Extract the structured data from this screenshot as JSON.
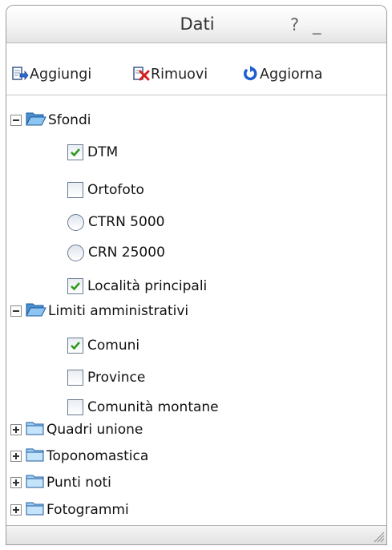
{
  "window": {
    "title": "Dati",
    "help_label": "?",
    "minimize_label": "_"
  },
  "toolbar": {
    "add_label": "Aggiungi",
    "remove_label": "Rimuovi",
    "refresh_label": "Aggiorna"
  },
  "tree": {
    "sfondi": {
      "label": "Sfondi",
      "expanded": true,
      "items": [
        {
          "label": "DTM",
          "control": "checkbox",
          "checked": true
        },
        {
          "label": "Ortofoto",
          "control": "checkbox",
          "checked": false
        },
        {
          "label": "CTRN 5000",
          "control": "radio",
          "checked": false
        },
        {
          "label": "CRN 25000",
          "control": "radio",
          "checked": false
        },
        {
          "label": "Località principali",
          "control": "checkbox",
          "checked": true
        }
      ]
    },
    "limiti": {
      "label": "Limiti amministrativi",
      "expanded": true,
      "items": [
        {
          "label": "Comuni",
          "control": "checkbox",
          "checked": true
        },
        {
          "label": "Province",
          "control": "checkbox",
          "checked": false
        },
        {
          "label": "Comunità montane",
          "control": "checkbox",
          "checked": false
        }
      ]
    },
    "collapsed": [
      {
        "label": "Quadri unione",
        "expanded": false
      },
      {
        "label": "Toponomastica",
        "expanded": false
      },
      {
        "label": "Punti noti",
        "expanded": false
      },
      {
        "label": "Fotogrammi",
        "expanded": false
      }
    ]
  },
  "colors": {
    "check_green": "#2e9a1e",
    "refresh_blue": "#1d5fd0",
    "remove_red": "#d81e1e",
    "folder_blue": "#6fb2ec"
  }
}
